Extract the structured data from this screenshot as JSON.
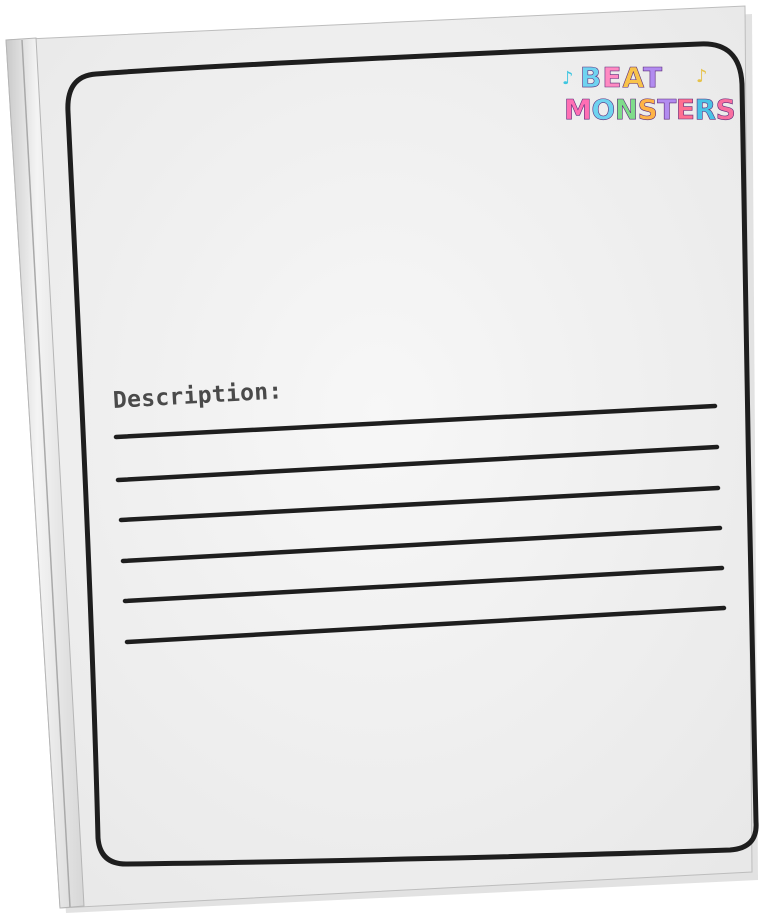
{
  "page": {
    "description_label": "Description:"
  },
  "logo": {
    "line1": "BEAT",
    "line2": "MONSTERS",
    "note_left": "♪",
    "note_right": "♪",
    "line1_colors": [
      "#6fd3f0",
      "#ff8ac2",
      "#f8c34a",
      "#b28cf0"
    ],
    "line2_colors": [
      "#ff6fb4",
      "#6fd3f0",
      "#7fdc8a",
      "#ffb347",
      "#b28cf0",
      "#ff6f91",
      "#4ac3e6",
      "#f86fa0"
    ]
  },
  "lines": {
    "count": 6
  },
  "colors": {
    "page": "#f1f1f1",
    "spine": "#dcdcdc",
    "ink": "#1e1e1e",
    "label": "#4a4a4a"
  }
}
